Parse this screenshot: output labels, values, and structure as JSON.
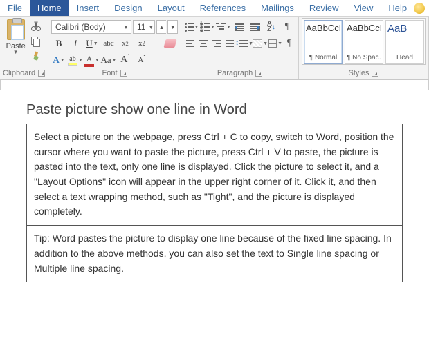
{
  "tabs": {
    "file": "File",
    "home": "Home",
    "insert": "Insert",
    "design": "Design",
    "layout": "Layout",
    "references": "References",
    "mailings": "Mailings",
    "review": "Review",
    "view": "View",
    "help": "Help",
    "active": "Home"
  },
  "ribbon": {
    "clipboard": {
      "label": "Clipboard",
      "paste": "Paste"
    },
    "font": {
      "label": "Font",
      "name": "Calibri (Body)",
      "size": "11",
      "bold": "B",
      "italic": "I",
      "underline": "U",
      "strike": "abc",
      "sub": "x",
      "subSup": "2",
      "sup": "x",
      "supSup": "2",
      "caseA": "Aa",
      "growA": "A",
      "shrinkA": "A",
      "fontColorA": "A",
      "effectsA": "A"
    },
    "paragraph": {
      "label": "Paragraph",
      "sort": "A\nZ"
    },
    "styles": {
      "label": "Styles",
      "preview": "AaBbCcDd",
      "previewShort": "AaB",
      "items": [
        {
          "name": "¶ Normal",
          "selected": true
        },
        {
          "name": "¶ No Spac…",
          "selected": false
        },
        {
          "name": "Head",
          "selected": false,
          "heading": true
        }
      ]
    }
  },
  "doc": {
    "title": "Paste picture show one line in Word",
    "rows": [
      "Select a picture on the webpage, press Ctrl + C to copy, switch to Word, position the cursor where you want to paste the picture, press Ctrl + V to paste, the picture is pasted into the text, only one line is displayed. Click the picture to select it, and a \"Layout Options\" icon will appear in the upper right corner of it. Click it, and then select a text wrapping method, such as \"Tight\", and the picture is displayed completely.",
      "Tip: Word pastes the picture to display one line because of the fixed line spacing. In addition to the above methods, you can also set the text to Single line spacing or Multiple line spacing."
    ]
  }
}
